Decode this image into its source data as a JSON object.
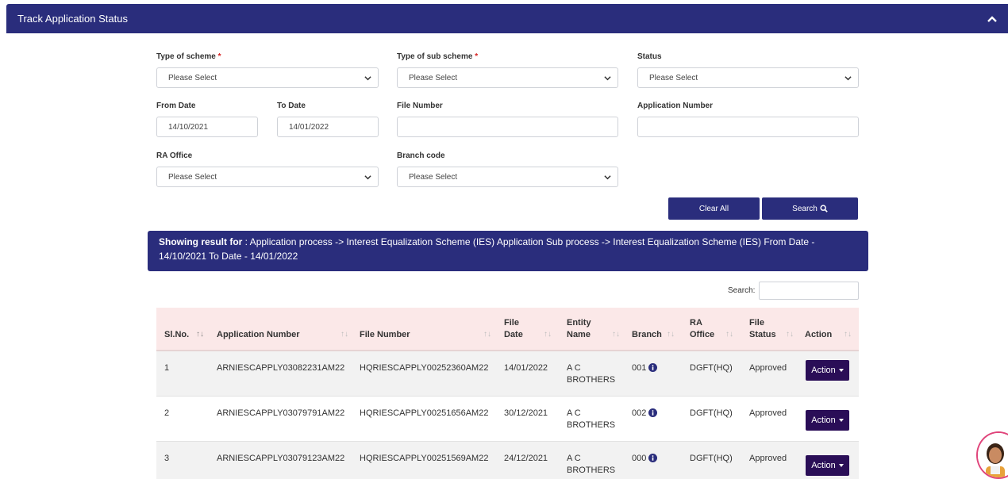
{
  "panel": {
    "title": "Track Application Status"
  },
  "form": {
    "scheme": {
      "label": "Type of scheme",
      "required_mark": "*",
      "value": "Please Select"
    },
    "sub_scheme": {
      "label": "Type of sub scheme",
      "required_mark": "*",
      "value": "Please Select"
    },
    "status": {
      "label": "Status",
      "value": "Please Select"
    },
    "from_date": {
      "label": "From Date",
      "value": "14/10/2021"
    },
    "to_date": {
      "label": "To Date",
      "value": "14/01/2022"
    },
    "file_number": {
      "label": "File Number",
      "value": ""
    },
    "application_number": {
      "label": "Application Number",
      "value": ""
    },
    "ra_office": {
      "label": "RA Office",
      "value": "Please Select"
    },
    "branch_code": {
      "label": "Branch code",
      "value": "Please Select"
    },
    "clear_label": "Clear All",
    "search_label": "Search"
  },
  "result": {
    "prefix": "Showing result for",
    "text": " : Application process -> Interest Equalization Scheme (IES) Application Sub process -> Interest Equalization Scheme (IES) From Date - 14/10/2021 To Date - 14/01/2022"
  },
  "table_search": {
    "label": "Search:",
    "value": ""
  },
  "table": {
    "headers": {
      "slno": "Sl.No.",
      "app_no": "Application Number",
      "file_no": "File Number",
      "file_date_1": "File",
      "file_date_2": "Date",
      "entity_1": "Entity",
      "entity_2": "Name",
      "branch": "Branch",
      "ra_1": "RA",
      "ra_2": "Office",
      "status_1": "File",
      "status_2": "Status",
      "action": "Action"
    },
    "rows": [
      {
        "slno": "1",
        "app_no": "ARNIESCAPPLY03082231AM22",
        "file_no": "HQRIESCAPPLY00252360AM22",
        "file_date": "14/01/2022",
        "entity_1": "A C",
        "entity_2": "BROTHERS",
        "branch": "001",
        "ra": "DGFT(HQ)",
        "status": "Approved",
        "action": "Action"
      },
      {
        "slno": "2",
        "app_no": "ARNIESCAPPLY03079791AM22",
        "file_no": "HQRIESCAPPLY00251656AM22",
        "file_date": "30/12/2021",
        "entity_1": "A C",
        "entity_2": "BROTHERS",
        "branch": "002",
        "ra": "DGFT(HQ)",
        "status": "Approved",
        "action": "Action"
      },
      {
        "slno": "3",
        "app_no": "ARNIESCAPPLY03079123AM22",
        "file_no": "HQRIESCAPPLY00251569AM22",
        "file_date": "24/12/2021",
        "entity_1": "A C",
        "entity_2": "BROTHERS",
        "branch": "000",
        "ra": "DGFT(HQ)",
        "status": "Approved",
        "action": "Action"
      }
    ]
  },
  "colors": {
    "header_bg": "#2a2d7c",
    "action_bg": "#2a0e57",
    "thead_bg": "#fbe8e8"
  },
  "icons": {
    "collapse": "chevron-up-icon",
    "select": "chevron-down-icon",
    "search": "search-icon",
    "info": "info-circle-icon",
    "sort": "sort-icon",
    "assistant": "chat-assistant-avatar"
  }
}
